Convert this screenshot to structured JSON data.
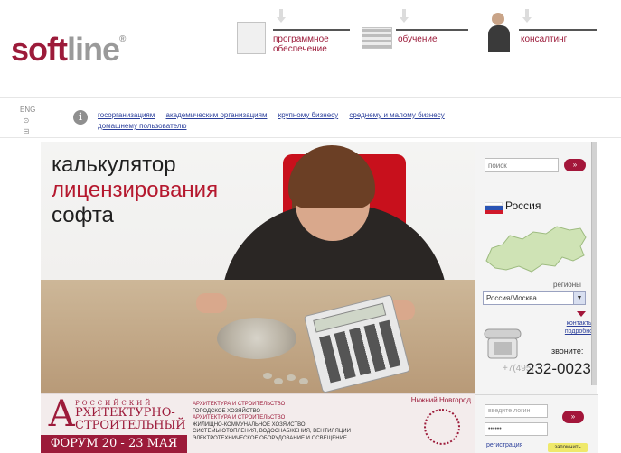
{
  "header": {
    "logo_soft": "soft",
    "logo_line": "line",
    "logo_reg": "®",
    "nav": [
      {
        "label": "программное обеспечение",
        "icon": "software-box-icon"
      },
      {
        "label": "обучение",
        "icon": "books-icon"
      },
      {
        "label": "консалтинг",
        "icon": "consultant-icon"
      }
    ]
  },
  "toolbar": {
    "side_icons": [
      "ENG",
      "⊙",
      "⊟"
    ],
    "info_icon": "i",
    "links": [
      "госорганизациям",
      "академическим организациям",
      "крупному бизнесу",
      "среднему и малому бизнесу",
      "домашнему пользователю"
    ]
  },
  "hero": {
    "title_line1": "калькулятор",
    "title_line2": "лицензирования",
    "title_line3": "софта"
  },
  "banner": {
    "big_letter": "А",
    "forum_top": "РОССИЙСКИЙ",
    "forum_line1": "РХИТЕКТУРНО-",
    "forum_line2": "СТРОИТЕЛЬНЫЙ",
    "forum_dates": "ФОРУМ 20 - 23 МАЯ",
    "city": "Нижний Новгород",
    "topics": [
      {
        "text": "архитектура и строительство",
        "red": true
      },
      {
        "text": "городское хозяйство",
        "red": false
      },
      {
        "text": "архитектура и строительство",
        "red": true
      },
      {
        "text": "жилищно-коммунальное хозяйство",
        "red": false
      },
      {
        "text": "системы отопления, водоснабжения, вентиляции",
        "red": false
      },
      {
        "text": "электротехническое оборудование и освещение",
        "red": false
      }
    ]
  },
  "sidebar": {
    "search_placeholder": "поиск",
    "search_button": "»",
    "country": "Россия",
    "regions_label": "регионы",
    "region_value": "Россия/Москва",
    "contacts_link": "контакты подробно",
    "call_label": "звоните:",
    "phone_prefix": "+7(495)",
    "phone_number": "232-0023",
    "login_placeholder": "введите логин",
    "password_value": "••••••",
    "login_button": "»",
    "register_link": "регистрация",
    "remember_label": "запомнить"
  },
  "colors": {
    "brand": "#9c1b3a",
    "link": "#2b3f9b",
    "chair": "#c8101c"
  }
}
